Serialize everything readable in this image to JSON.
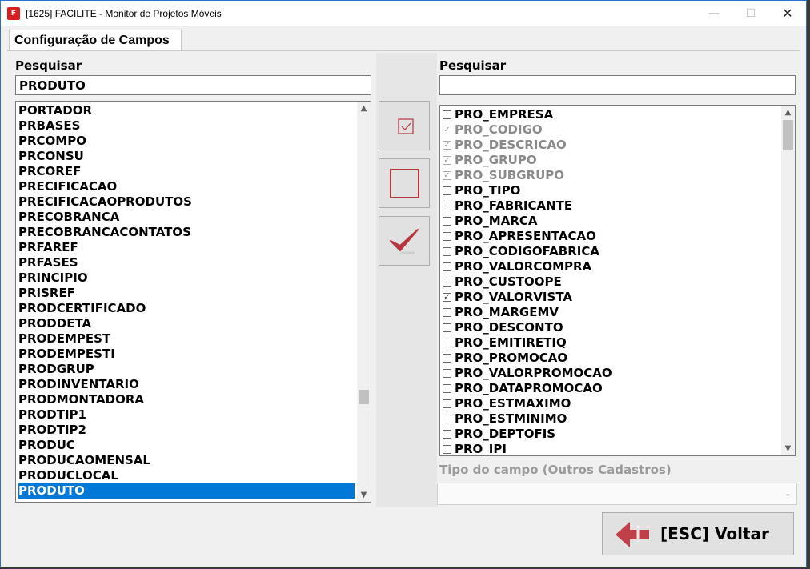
{
  "window": {
    "title": "[1625] FACILITE - Monitor de Projetos Móveis",
    "minimize": "—",
    "maximize": "☐",
    "close": "✕",
    "app_icon_text": "F"
  },
  "tab": {
    "label": "Configuração de Campos"
  },
  "left": {
    "search_label": "Pesquisar",
    "search_value": "PRODUTO",
    "items": [
      "PORTADOR",
      "PRBASES",
      "PRCOMPO",
      "PRCONSU",
      "PRCOREF",
      "PRECIFICACAO",
      "PRECIFICACAOPRODUTOS",
      "PRECOBRANCA",
      "PRECOBRANCACONTATOS",
      "PRFAREF",
      "PRFASES",
      "PRINCIPIO",
      "PRISREF",
      "PRODCERTIFICADO",
      "PRODDETA",
      "PRODEMPEST",
      "PRODEMPESTI",
      "PRODGRUP",
      "PRODINVENTARIO",
      "PRODMONTADORA",
      "PRODTIP1",
      "PRODTIP2",
      "PRODUC",
      "PRODUCAOMENSAL",
      "PRODUCLOCAL",
      "PRODUTO"
    ],
    "selected_index": 25
  },
  "right": {
    "search_label": "Pesquisar",
    "search_value": "",
    "fields": [
      {
        "name": "PRO_EMPRESA",
        "checked": false,
        "disabled": false
      },
      {
        "name": "PRO_CODIGO",
        "checked": true,
        "disabled": true
      },
      {
        "name": "PRO_DESCRICAO",
        "checked": true,
        "disabled": true
      },
      {
        "name": "PRO_GRUPO",
        "checked": true,
        "disabled": true
      },
      {
        "name": "PRO_SUBGRUPO",
        "checked": true,
        "disabled": true
      },
      {
        "name": "PRO_TIPO",
        "checked": false,
        "disabled": false
      },
      {
        "name": "PRO_FABRICANTE",
        "checked": false,
        "disabled": false
      },
      {
        "name": "PRO_MARCA",
        "checked": false,
        "disabled": false
      },
      {
        "name": "PRO_APRESENTACAO",
        "checked": false,
        "disabled": false
      },
      {
        "name": "PRO_CODIGOFABRICA",
        "checked": false,
        "disabled": false
      },
      {
        "name": "PRO_VALORCOMPRA",
        "checked": false,
        "disabled": false
      },
      {
        "name": "PRO_CUSTOOPE",
        "checked": false,
        "disabled": false
      },
      {
        "name": "PRO_VALORVISTA",
        "checked": true,
        "disabled": false
      },
      {
        "name": "PRO_MARGEMV",
        "checked": false,
        "disabled": false
      },
      {
        "name": "PRO_DESCONTO",
        "checked": false,
        "disabled": false
      },
      {
        "name": "PRO_EMITIRETIQ",
        "checked": false,
        "disabled": false
      },
      {
        "name": "PRO_PROMOCAO",
        "checked": false,
        "disabled": false
      },
      {
        "name": "PRO_VALORPROMOCAO",
        "checked": false,
        "disabled": false
      },
      {
        "name": "PRO_DATAPROMOCAO",
        "checked": false,
        "disabled": false
      },
      {
        "name": "PRO_ESTMAXIMO",
        "checked": false,
        "disabled": false
      },
      {
        "name": "PRO_ESTMINIMO",
        "checked": false,
        "disabled": false
      },
      {
        "name": "PRO_DEPTOFIS",
        "checked": false,
        "disabled": false
      },
      {
        "name": "PRO_IPI",
        "checked": false,
        "disabled": false
      }
    ],
    "tipo_label": "Tipo do campo (Outros Cadastros)",
    "tipo_value": ""
  },
  "footer": {
    "voltar_label": "[ESC] Voltar"
  },
  "colors": {
    "accent": "#0078d7",
    "icon_red": "#b5363f",
    "window_border": "#2a6fc9"
  }
}
